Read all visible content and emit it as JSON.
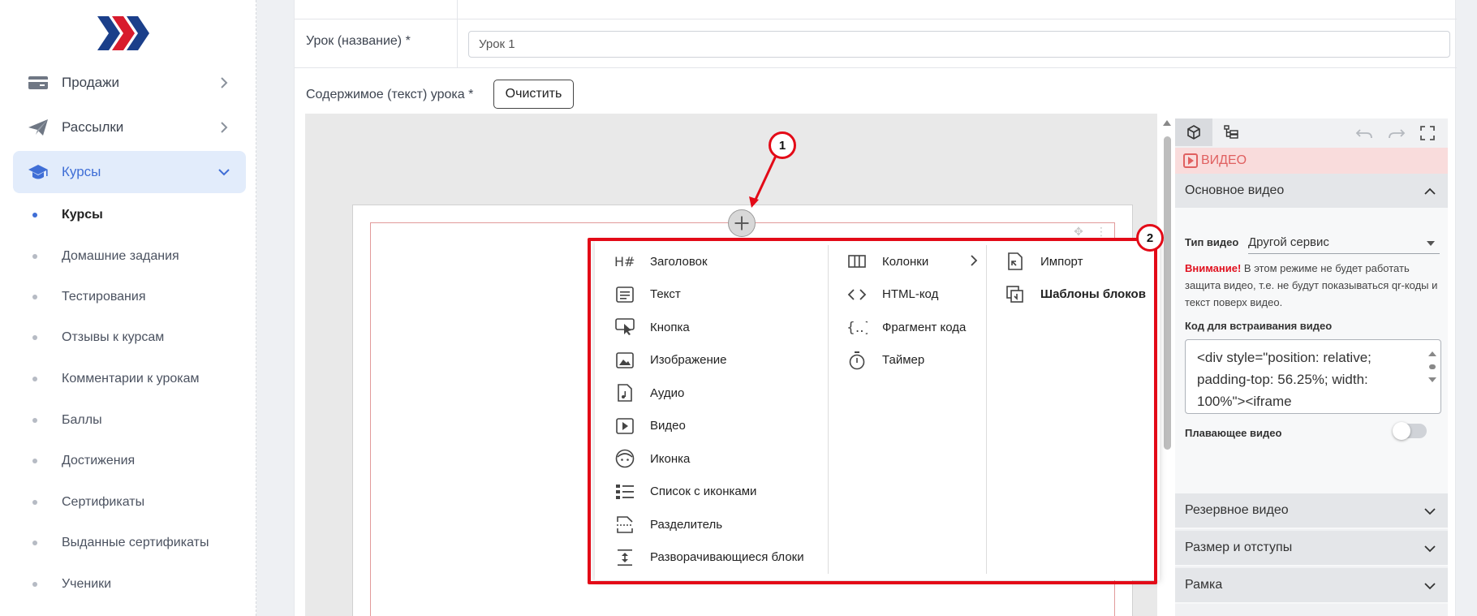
{
  "sidebar": {
    "items": [
      {
        "label": "Продажи",
        "icon": "wallet-icon",
        "expanded": false
      },
      {
        "label": "Рассылки",
        "icon": "paper-plane-icon",
        "expanded": false
      },
      {
        "label": "Курсы",
        "icon": "graduation-cap-icon",
        "expanded": true
      }
    ],
    "subitems": [
      "Курсы",
      "Домашние задания",
      "Тестирования",
      "Отзывы к курсам",
      "Комментарии к урокам",
      "Баллы",
      "Достижения",
      "Сертификаты",
      "Выданные сертификаты",
      "Ученики"
    ],
    "accent_color": "#3f6ed6"
  },
  "form": {
    "lesson_label": "Урок (название) *",
    "lesson_value": "Урок 1",
    "content_label": "Содержимое (текст) урока *",
    "clear_button": "Очистить"
  },
  "block_menu": {
    "col1": [
      "Заголовок",
      "Текст",
      "Кнопка",
      "Изображение",
      "Аудио",
      "Видео",
      "Иконка",
      "Список с иконками",
      "Разделитель",
      "Разворачивающиеся блоки"
    ],
    "col2": [
      "Колонки",
      "HTML-код",
      "Фрагмент кода",
      "Таймер"
    ],
    "col3": [
      "Импорт",
      "Шаблоны блоков"
    ]
  },
  "callouts": {
    "first": "1",
    "second": "2"
  },
  "panel": {
    "badge": "ВИДЕО",
    "main_section": "Основное видео",
    "video_type_label": "Тип видео",
    "video_type_value": "Другой сервис",
    "warning_title": "Внимание!",
    "warning_text": " В этом режиме не будет работать защита видео, т.е. не будут показываться qr-коды и текст поверх видео.",
    "embed_label": "Код для встраивания видео",
    "embed_code": "<div style=\"position: relative; padding-top: 56.25%; width: 100%\"><iframe",
    "floating_label": "Плавающее видео",
    "floating_on": false,
    "sections": [
      "Резервное видео",
      "Размер и отступы",
      "Рамка"
    ]
  },
  "colors": {
    "annotation_red": "#e30a17",
    "video_badge_bg": "#f9dcdc"
  }
}
